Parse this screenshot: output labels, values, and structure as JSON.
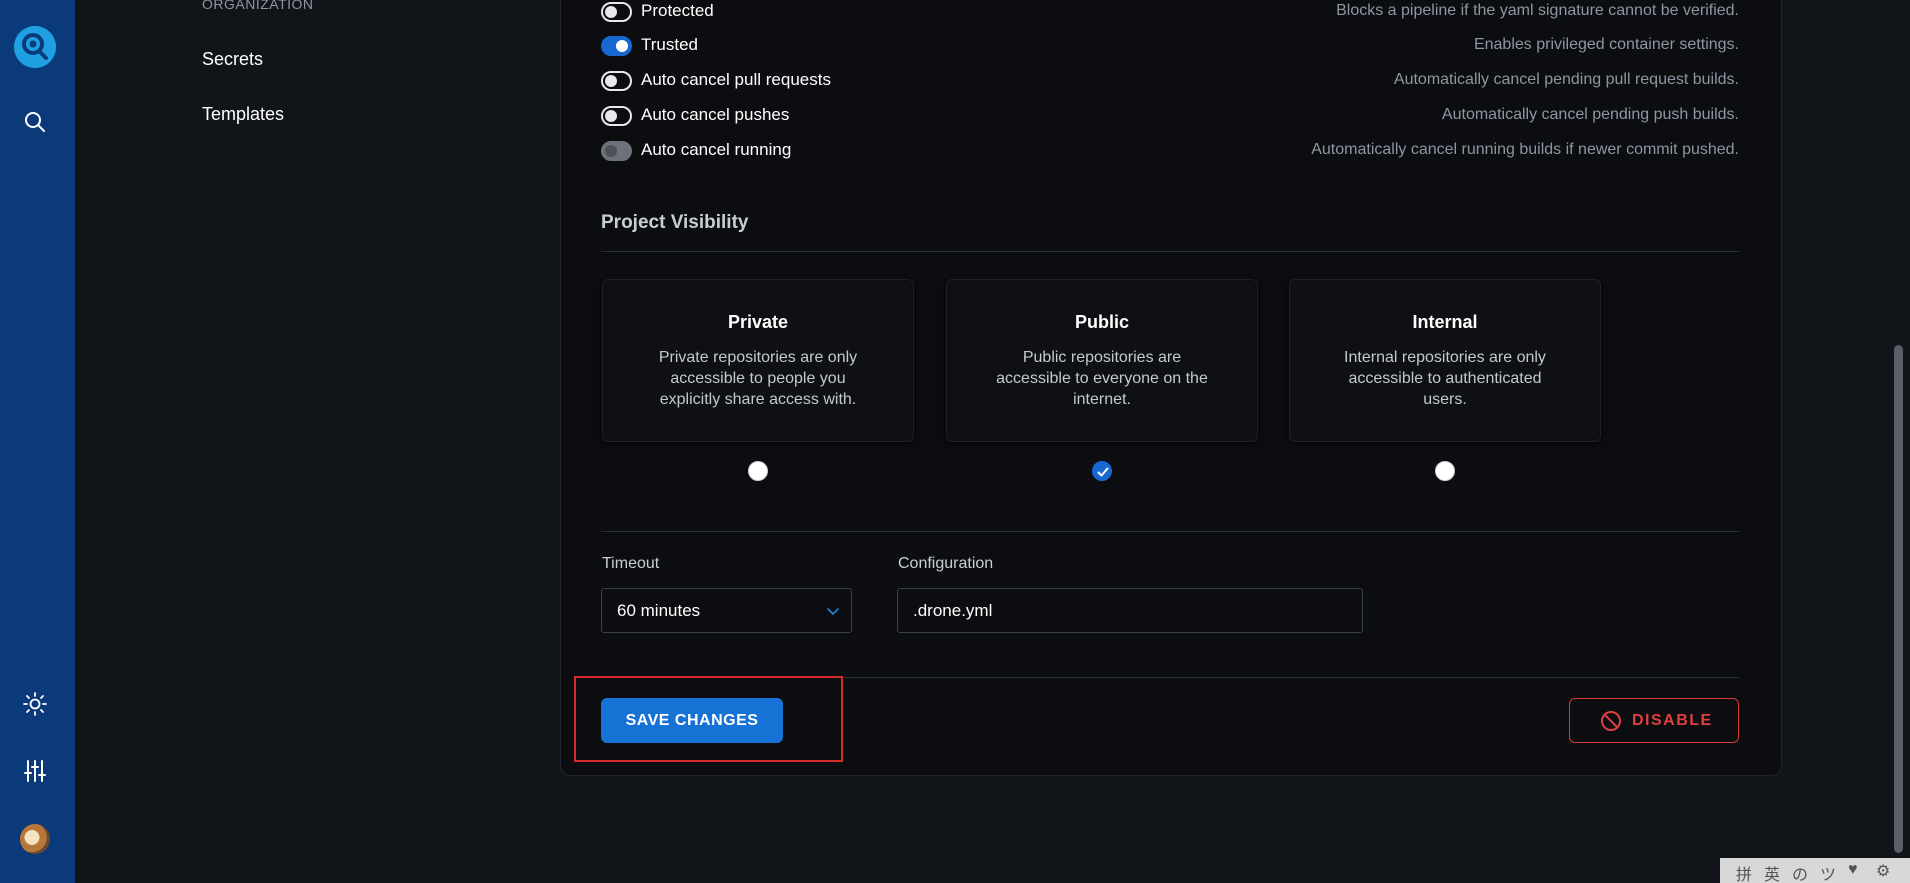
{
  "sidebar": {
    "section_label": "ORGANIZATION",
    "items": [
      {
        "label": "Secrets"
      },
      {
        "label": "Templates"
      }
    ]
  },
  "settings": {
    "toggles": [
      {
        "label": "Protected",
        "description": "Blocks a pipeline if the yaml signature cannot be verified.",
        "state": "off"
      },
      {
        "label": "Trusted",
        "description": "Enables privileged container settings.",
        "state": "on"
      },
      {
        "label": "Auto cancel pull requests",
        "description": "Automatically cancel pending pull request builds.",
        "state": "off"
      },
      {
        "label": "Auto cancel pushes",
        "description": "Automatically cancel pending push builds.",
        "state": "off"
      },
      {
        "label": "Auto cancel running",
        "description": "Automatically cancel running builds if newer commit pushed.",
        "state": "disabled"
      }
    ]
  },
  "visibility": {
    "title": "Project Visibility",
    "options": [
      {
        "title": "Private",
        "description": "Private repositories are only accessible to people you explicitly share access with.",
        "selected": false
      },
      {
        "title": "Public",
        "description": "Public repositories are accessible to everyone on the internet.",
        "selected": true
      },
      {
        "title": "Internal",
        "description": "Internal repositories are only accessible to authenticated users.",
        "selected": false
      }
    ]
  },
  "timeout": {
    "label": "Timeout",
    "value": "60 minutes"
  },
  "configuration": {
    "label": "Configuration",
    "value": ".drone.yml"
  },
  "actions": {
    "save_label": "SAVE CHANGES",
    "disable_label": "DISABLE"
  },
  "ime": {
    "glyphs": [
      "拼",
      "英",
      "の",
      "ツ",
      "♥",
      "⚙"
    ]
  },
  "colors": {
    "accent": "#1772d6",
    "danger": "#e04040",
    "rail": "#0b3a7a"
  }
}
